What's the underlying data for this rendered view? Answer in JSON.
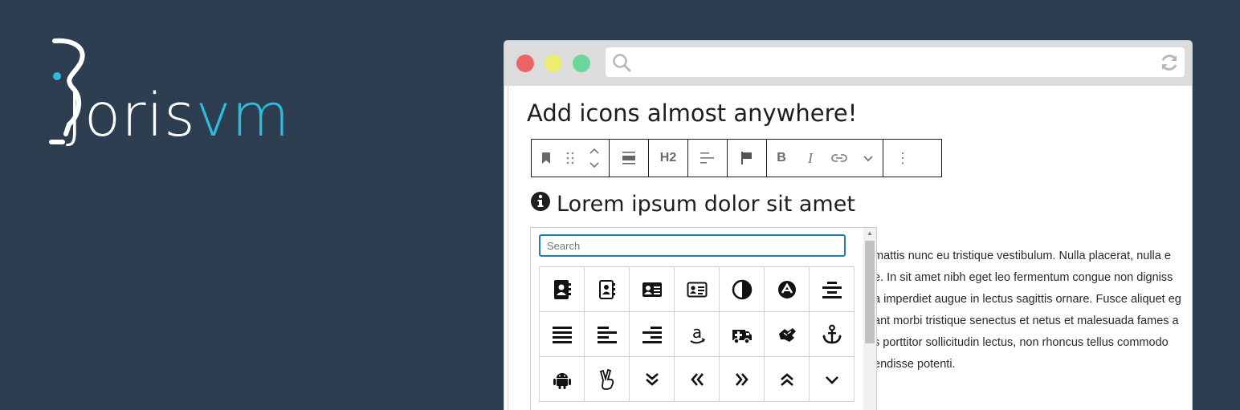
{
  "logo": {
    "text_main": "Joris",
    "text_accent": "vm"
  },
  "browser": {
    "window_controls": [
      "close",
      "minimize",
      "maximize"
    ],
    "url_value": ""
  },
  "editor": {
    "heading": "Add icons almost anywhere!",
    "toolbar": {
      "heading_level": "H2",
      "bold": "B",
      "italic": "I",
      "more": "⋮"
    },
    "block_heading": "Lorem ipsum dolor sit amet",
    "paragraph_lines": [
      "mattis nunc eu tristique vestibulum. Nulla placerat, nulla e",
      "e. In sit amet nibh eget leo fermentum congue non digniss",
      "a imperdiet augue in lectus sagittis ornare. Fusce aliquet eg",
      "ant morbi tristique senectus et netus et malesuada fames a",
      "s porttitor sollicitudin lectus, non rhoncus tellus commodo",
      "endisse potenti."
    ]
  },
  "icon_picker": {
    "search_placeholder": "Search",
    "search_value": "",
    "icons": [
      "address-book",
      "address-book-outline",
      "address-card",
      "address-card-outline",
      "adjust",
      "angellist-circle",
      "align-center",
      "align-justify",
      "align-left",
      "align-right",
      "amazon",
      "ambulance",
      "sign-language",
      "anchor",
      "android",
      "peace-hand",
      "angle-double-down",
      "angle-double-left",
      "angle-double-right",
      "angle-double-up",
      "angle-down"
    ]
  },
  "colors": {
    "background": "#2e3e51",
    "logo_accent": "#2ebbdc",
    "search_focus": "#1e7eb7"
  }
}
